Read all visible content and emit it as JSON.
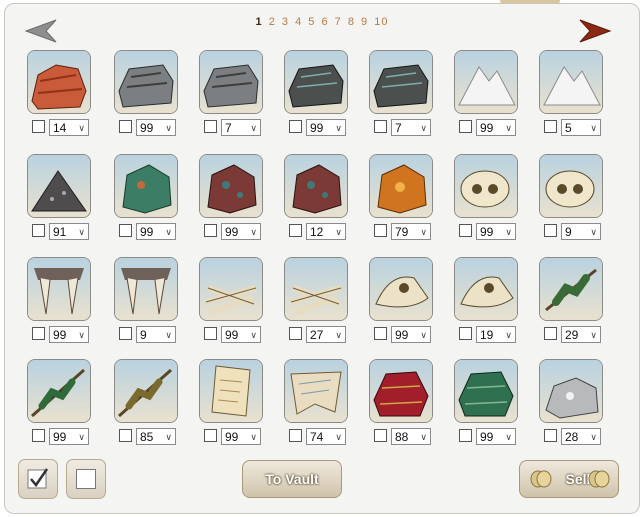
{
  "pagination": {
    "current": "1",
    "pages": [
      "1",
      "2",
      "3",
      "4",
      "5",
      "6",
      "7",
      "8",
      "9",
      "10"
    ]
  },
  "items": [
    {
      "icon": "red-rock-icon",
      "qty": "14"
    },
    {
      "icon": "grey-stone-icon",
      "qty": "99"
    },
    {
      "icon": "grey-stone-icon",
      "qty": "7"
    },
    {
      "icon": "dark-stone-icon",
      "qty": "99"
    },
    {
      "icon": "dark-stone-icon",
      "qty": "7"
    },
    {
      "icon": "salt-pile-icon",
      "qty": "99"
    },
    {
      "icon": "salt-pile-icon",
      "qty": "5"
    },
    {
      "icon": "gravel-pile-icon",
      "qty": "91"
    },
    {
      "icon": "green-ore-icon",
      "qty": "99"
    },
    {
      "icon": "red-ore-icon",
      "qty": "99"
    },
    {
      "icon": "red-ore-icon",
      "qty": "12"
    },
    {
      "icon": "amber-ore-icon",
      "qty": "79"
    },
    {
      "icon": "skull-icon",
      "qty": "99"
    },
    {
      "icon": "skull-icon",
      "qty": "9"
    },
    {
      "icon": "fang-jaw-icon",
      "qty": "99"
    },
    {
      "icon": "fang-jaw-icon",
      "qty": "9"
    },
    {
      "icon": "bone-pile-icon",
      "qty": "99"
    },
    {
      "icon": "bone-pile-icon",
      "qty": "27"
    },
    {
      "icon": "beak-skull-icon",
      "qty": "99"
    },
    {
      "icon": "beak-skull-icon",
      "qty": "19"
    },
    {
      "icon": "pine-branch-icon",
      "qty": "29"
    },
    {
      "icon": "green-branch-icon",
      "qty": "99"
    },
    {
      "icon": "olive-branch-icon",
      "qty": "85"
    },
    {
      "icon": "scroll-icon",
      "qty": "99"
    },
    {
      "icon": "tattered-cloth-icon",
      "qty": "74"
    },
    {
      "icon": "red-cloth-icon",
      "qty": "88"
    },
    {
      "icon": "green-cloth-icon",
      "qty": "99"
    },
    {
      "icon": "silver-ore-icon",
      "qty": "28"
    }
  ],
  "buttons": {
    "select_all_icon": "checkmark-icon",
    "deselect_all_icon": "empty-box-icon",
    "to_vault": "To Vault",
    "sell": "Sell",
    "sell_icon": "coins-icon"
  },
  "colors": {
    "page_current": "#3c2a16",
    "page_link": "#b77b46",
    "arrow_left": "#8e8e8e",
    "arrow_right": "#8b2a12"
  }
}
